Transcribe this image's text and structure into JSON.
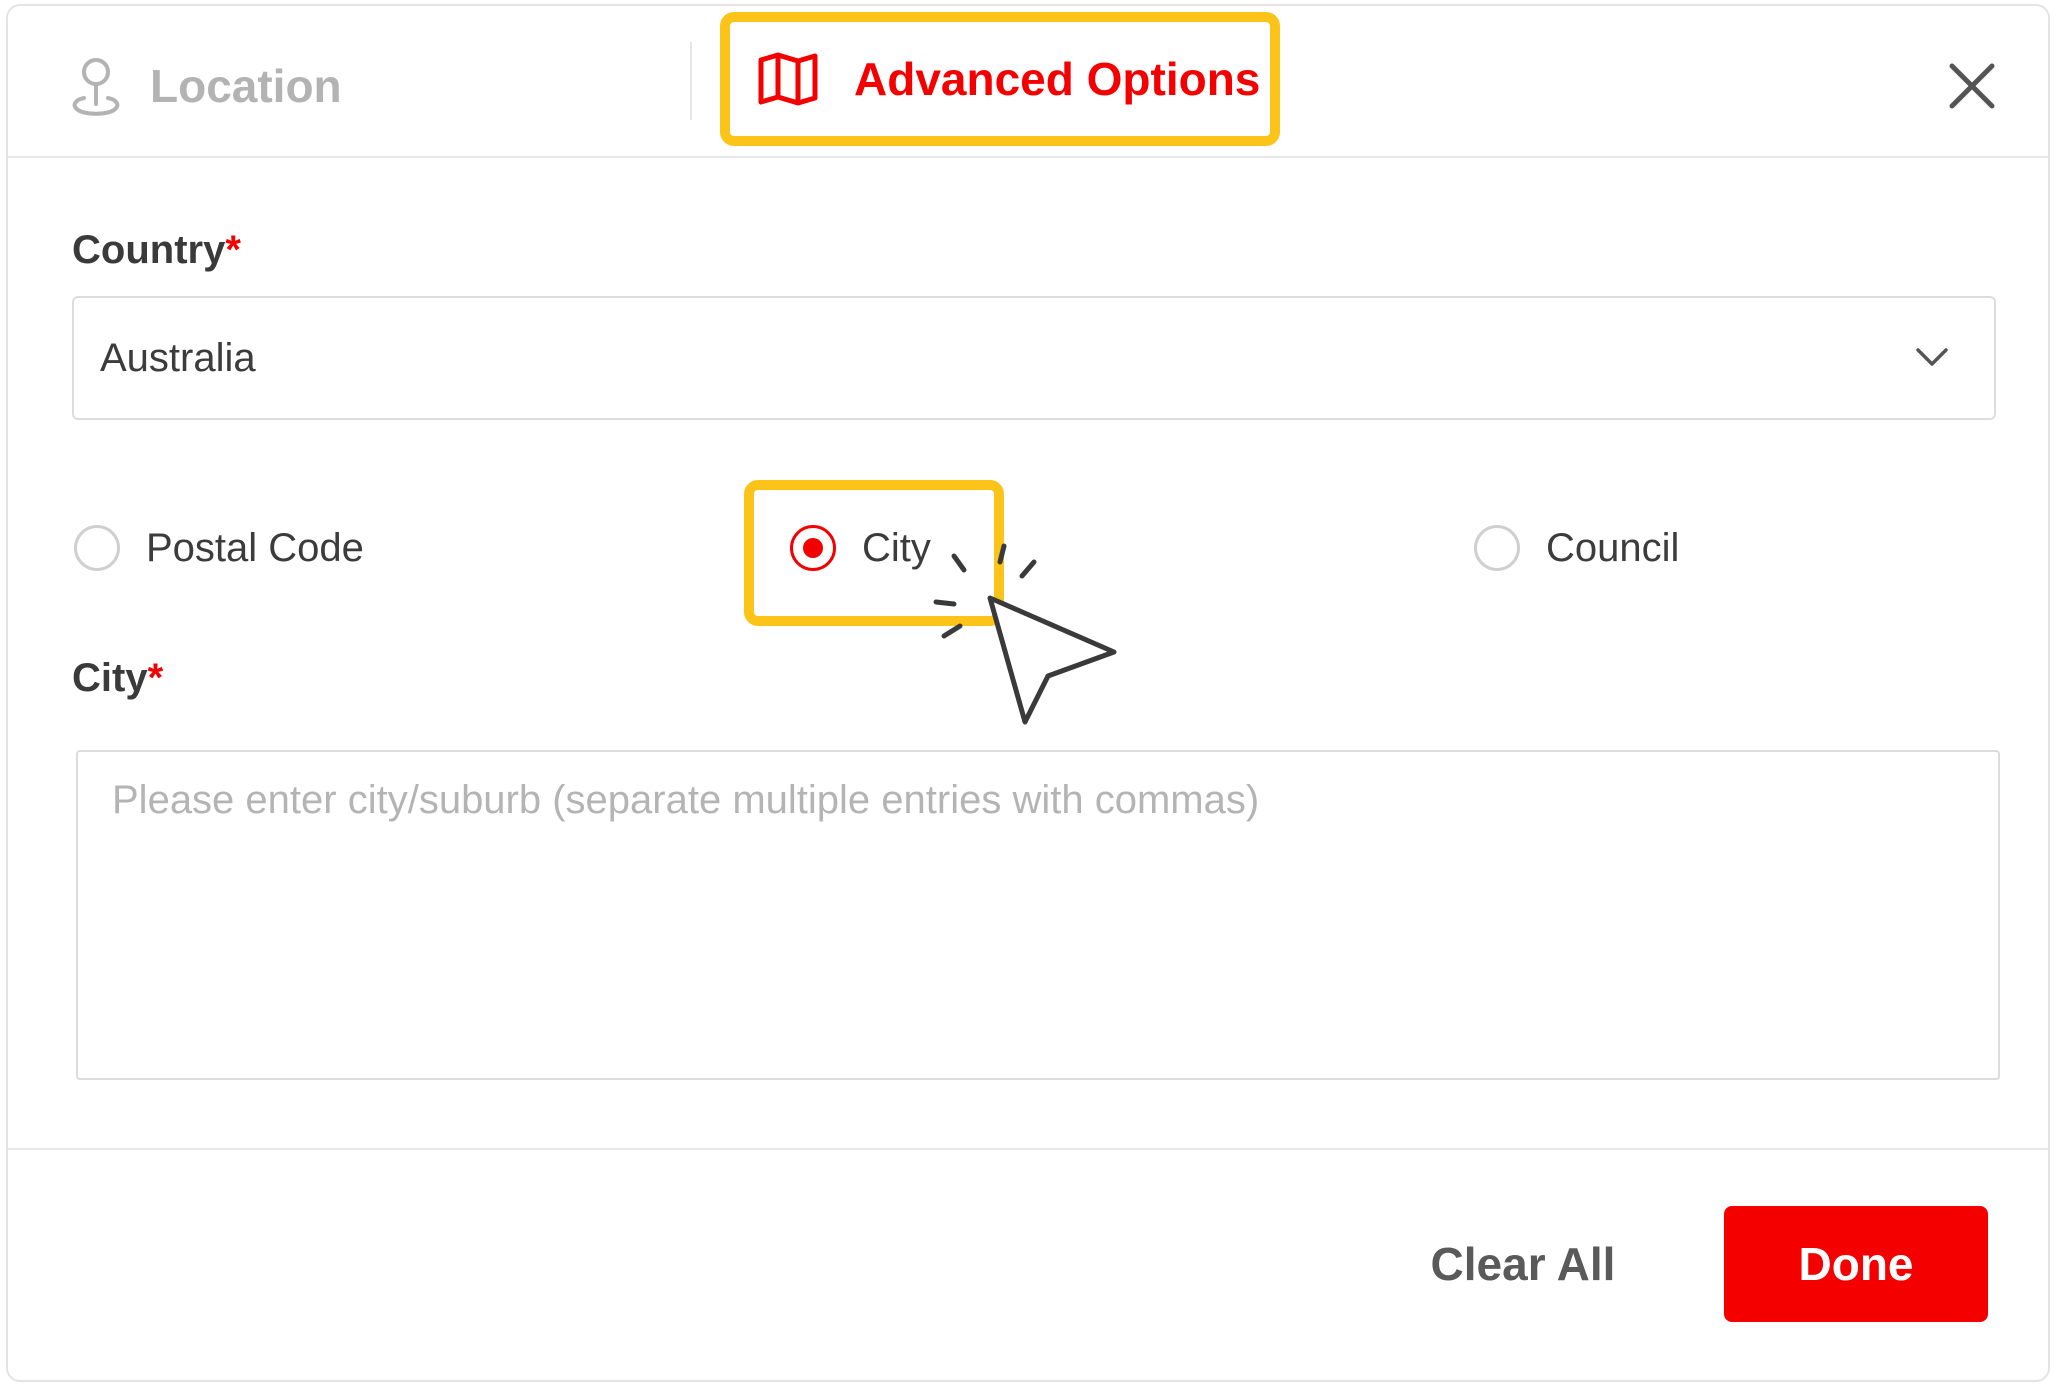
{
  "tabs": {
    "location": {
      "label": "Location",
      "icon": "map-pin-icon",
      "active": false
    },
    "advanced": {
      "label": "Advanced Options",
      "icon": "map-icon",
      "active": true
    }
  },
  "header": {
    "close_icon": "close-icon"
  },
  "country": {
    "label": "Country",
    "required_mark": "*",
    "selected_value": "Australia",
    "chevron_icon": "chevron-down-icon"
  },
  "location_type": {
    "options": [
      {
        "label": "Postal Code",
        "checked": false
      },
      {
        "label": "City",
        "checked": true
      },
      {
        "label": "Council",
        "checked": false
      }
    ]
  },
  "city": {
    "label": "City",
    "required_mark": "*",
    "value": "",
    "placeholder": "Please enter city/suburb (separate multiple entries with commas)"
  },
  "footer": {
    "clear_label": "Clear All",
    "done_label": "Done"
  },
  "colors": {
    "accent": "#f40000",
    "highlight": "#fcc419",
    "muted_text": "#b3b3b3",
    "text": "#3c3c3c",
    "border": "#dcdcdc"
  }
}
